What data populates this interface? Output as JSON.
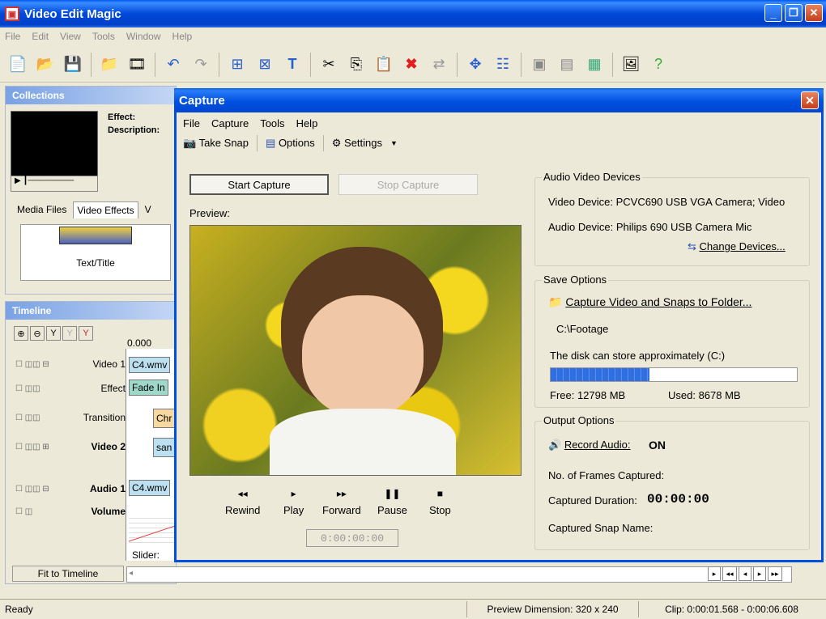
{
  "app": {
    "title": "Video Edit Magic",
    "menu": [
      "File",
      "Edit",
      "View",
      "Tools",
      "Window",
      "Help"
    ]
  },
  "collections": {
    "title": "Collections",
    "effect_label": "Effect:",
    "description_label": "Description:",
    "tabs": [
      "Media Files",
      "Video Effects",
      "V"
    ],
    "item_label": "Text/Title"
  },
  "timeline": {
    "title": "Timeline",
    "time": "0.000",
    "tracks": [
      {
        "name": "Video 1",
        "clip": "C4.wmv"
      },
      {
        "name": "Effect",
        "clip": "Fade In"
      },
      {
        "name": "Transition",
        "clip": "Chr"
      },
      {
        "name": "Video 2",
        "clip": "san"
      },
      {
        "name": "Audio 1",
        "clip": "C4.wmv"
      },
      {
        "name": "Volume",
        "clip": ""
      }
    ],
    "slider_label": "Slider:",
    "fit_button": "Fit to Timeline"
  },
  "status": {
    "ready": "Ready",
    "preview_dim": "Preview Dimension: 320 x 240",
    "clip": "Clip: 0:00:01.568 - 0:00:06.608"
  },
  "capture": {
    "title": "Capture",
    "menu": [
      "File",
      "Capture",
      "Tools",
      "Help"
    ],
    "toolbar": {
      "snap": "Take Snap",
      "options": "Options",
      "settings": "Settings"
    },
    "start": "Start Capture",
    "stop": "Stop Capture",
    "preview_label": "Preview:",
    "playback": [
      {
        "glyph": "◂◂",
        "label": "Rewind"
      },
      {
        "glyph": "▸",
        "label": "Play"
      },
      {
        "glyph": "▸▸",
        "label": "Forward"
      },
      {
        "glyph": "❚❚",
        "label": "Pause"
      },
      {
        "glyph": "■",
        "label": "Stop"
      }
    ],
    "timecode": "0:00:00:00",
    "av": {
      "title": "Audio Video Devices",
      "video": "Video Device:  PCVC690 USB VGA Camera; Video",
      "audio": "Audio Device: Philips 690 USB Camera Mic",
      "change": "Change Devices..."
    },
    "save": {
      "title": "Save Options",
      "folder_link": "Capture Video and Snaps to Folder...",
      "path": "C:\\Footage",
      "disk": "The disk can store approximately  (C:)",
      "used_fraction": 0.4,
      "free": "Free:  12798 MB",
      "used": "Used:  8678 MB"
    },
    "output": {
      "title": "Output Options",
      "record": "Record Audio:",
      "record_state": "ON",
      "frames": "No. of Frames Captured:",
      "duration_label": "Captured Duration:",
      "duration": "00:00:00",
      "snap": "Captured Snap Name:"
    }
  },
  "colors": {
    "xp_blue": "#0050e0",
    "progress": "#2f6fe0"
  }
}
